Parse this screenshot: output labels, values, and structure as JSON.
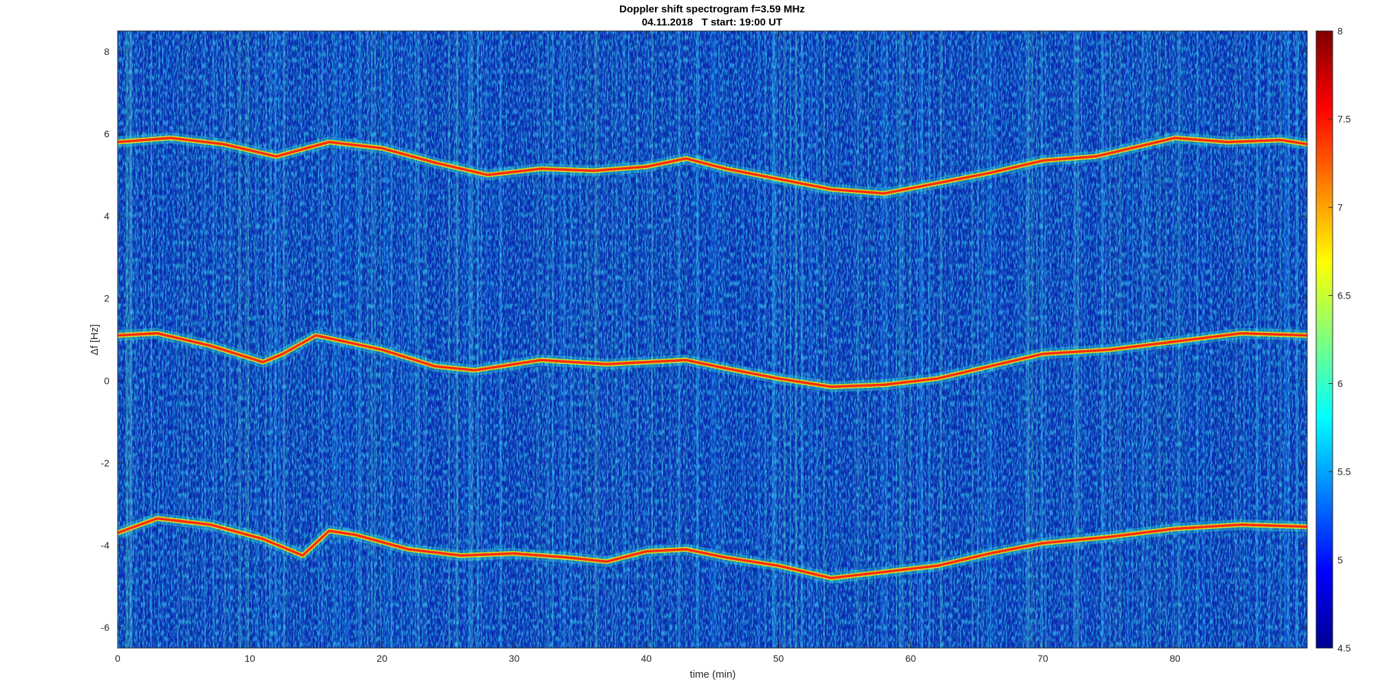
{
  "chart_data": {
    "type": "heatmap",
    "title": "Doppler shift spectrogram f=3.59 MHz",
    "subtitle": "04.11.2018   T start: 19:00 UT",
    "xlabel": "time (min)",
    "ylabel": "Δf [Hz]",
    "xlim": [
      0,
      90
    ],
    "ylim": [
      -6.5,
      8.5
    ],
    "xticks": [
      0,
      10,
      20,
      30,
      40,
      50,
      60,
      70,
      80
    ],
    "yticks": [
      -6,
      -4,
      -2,
      0,
      2,
      4,
      6,
      8
    ],
    "colorbar": {
      "colormap": "jet",
      "range": [
        4.5,
        8
      ],
      "ticks": [
        4.5,
        5,
        5.5,
        6,
        6.5,
        7,
        7.5,
        8
      ]
    },
    "series": [
      {
        "x": [
          0,
          4,
          8,
          12,
          16,
          20,
          24,
          28,
          32,
          36,
          40,
          43,
          46,
          50,
          54,
          58,
          62,
          66,
          70,
          74,
          78,
          80,
          84,
          88,
          90
        ],
        "y": [
          5.8,
          5.9,
          5.75,
          5.45,
          5.8,
          5.65,
          5.3,
          5.0,
          5.15,
          5.1,
          5.2,
          5.4,
          5.15,
          4.9,
          4.65,
          4.55,
          4.8,
          5.05,
          5.35,
          5.45,
          5.75,
          5.9,
          5.8,
          5.85,
          5.75
        ]
      },
      {
        "x": [
          0,
          3,
          7,
          11,
          12.5,
          15,
          20,
          24,
          27,
          32,
          37,
          40,
          43,
          46,
          50,
          54,
          58,
          62,
          66,
          70,
          75,
          80,
          85,
          90
        ],
        "y": [
          1.1,
          1.15,
          0.85,
          0.45,
          0.65,
          1.1,
          0.75,
          0.35,
          0.25,
          0.5,
          0.4,
          0.45,
          0.5,
          0.3,
          0.05,
          -0.15,
          -0.1,
          0.05,
          0.35,
          0.65,
          0.75,
          0.95,
          1.15,
          1.1
        ]
      },
      {
        "x": [
          0,
          3,
          7,
          11,
          14,
          16,
          18,
          22,
          26,
          30,
          34,
          37,
          40,
          43,
          46,
          50,
          54,
          58,
          62,
          66,
          70,
          75,
          80,
          85,
          90
        ],
        "y": [
          -3.7,
          -3.35,
          -3.5,
          -3.85,
          -4.25,
          -3.65,
          -3.75,
          -4.1,
          -4.25,
          -4.2,
          -4.3,
          -4.4,
          -4.15,
          -4.1,
          -4.3,
          -4.5,
          -4.8,
          -4.65,
          -4.5,
          -4.2,
          -3.95,
          -3.8,
          -3.6,
          -3.5,
          -3.55
        ]
      }
    ]
  }
}
